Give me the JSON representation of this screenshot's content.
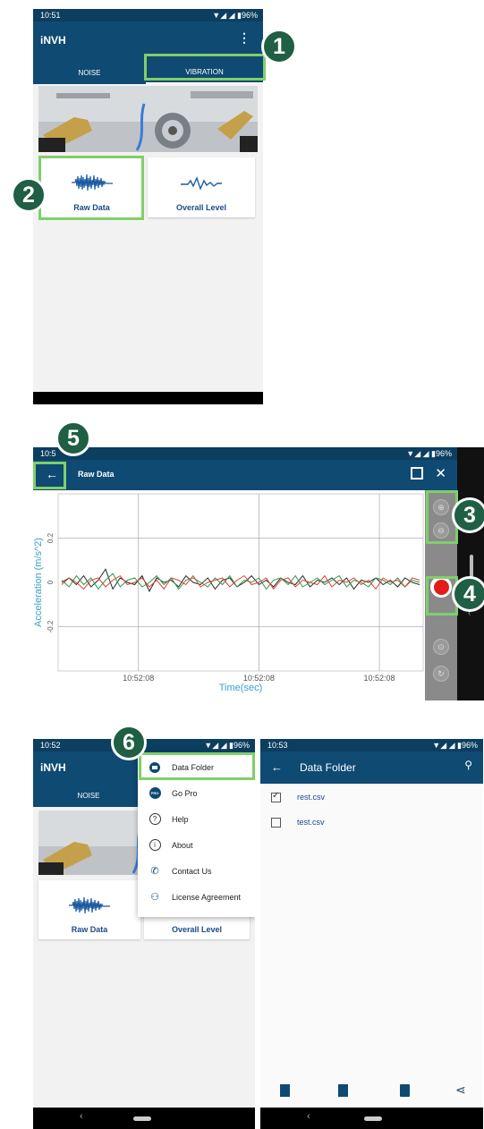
{
  "panel1": {
    "status": {
      "time": "10:51",
      "icons": "▼◢ ◢ ▮96%"
    },
    "app_title": "iNVH",
    "tabs": [
      {
        "label": "NOISE"
      },
      {
        "label": "VIBRATION"
      }
    ],
    "cards": [
      {
        "label": "Raw Data",
        "icon": "waveform-icon"
      },
      {
        "label": "Overall Level",
        "icon": "pulse-line-icon"
      }
    ]
  },
  "panel2": {
    "status": {
      "time": "10:5",
      "icons": "▼◢ ◢ ▮96%"
    },
    "title": "Raw Data",
    "chart_data": {
      "type": "line",
      "xlabel": "Time(sec)",
      "ylabel": "Acceleration (m/s^2)",
      "x_ticks": [
        "10:52:08",
        "10:52:08",
        "10:52:08"
      ],
      "y_ticks": [
        "0.2",
        "0",
        "-0.2"
      ],
      "ylim": [
        -0.4,
        0.4
      ],
      "grid": true,
      "series": [
        {
          "color": "#2a2a2a",
          "values": [
            0.0,
            0.02,
            -0.01,
            0.03,
            -0.02,
            0.01,
            0.06,
            -0.03,
            0.02,
            0.0,
            -0.01,
            0.03,
            -0.04,
            0.02,
            0.0,
            0.01,
            -0.02,
            0.03,
            0.0,
            -0.01,
            0.02,
            -0.03,
            0.01,
            0.02,
            -0.02,
            0.0,
            0.03,
            -0.01,
            0.01,
            -0.02,
            0.02,
            0.0,
            -0.01,
            0.03,
            -0.02,
            0.01,
            0.0,
            0.02,
            -0.01,
            0.02,
            -0.03,
            0.01,
            0.0,
            0.02,
            -0.01,
            0.01,
            -0.02,
            0.02,
            0.0,
            -0.01
          ]
        },
        {
          "color": "#2e9a4a",
          "values": [
            0.01,
            -0.02,
            0.03,
            -0.01,
            0.02,
            -0.03,
            0.01,
            0.04,
            -0.02,
            0.01,
            0.02,
            -0.02,
            0.0,
            0.03,
            -0.01,
            0.02,
            -0.03,
            0.01,
            0.02,
            0.0,
            -0.02,
            0.02,
            -0.01,
            0.03,
            -0.02,
            0.01,
            0.0,
            0.02,
            -0.03,
            0.01,
            0.02,
            -0.01,
            0.03,
            -0.02,
            0.0,
            0.02,
            -0.01,
            0.01,
            0.03,
            -0.02,
            0.01,
            0.0,
            -0.02,
            0.02,
            0.01,
            -0.01,
            0.02,
            -0.02,
            0.01,
            0.0
          ]
        },
        {
          "color": "#d9443a",
          "values": [
            -0.01,
            0.02,
            0.0,
            -0.03,
            0.01,
            0.02,
            -0.02,
            0.01,
            0.03,
            -0.01,
            0.0,
            0.02,
            -0.02,
            0.01,
            -0.03,
            0.02,
            0.01,
            -0.01,
            0.03,
            -0.02,
            0.0,
            0.01,
            0.02,
            -0.02,
            0.01,
            0.03,
            -0.01,
            0.0,
            0.02,
            -0.03,
            0.01,
            0.02,
            -0.02,
            0.01,
            0.0,
            -0.01,
            0.03,
            -0.02,
            0.01,
            0.0,
            0.02,
            -0.01,
            0.01,
            -0.03,
            0.02,
            0.0,
            0.01,
            -0.02,
            0.02,
            0.01
          ]
        }
      ]
    }
  },
  "panel3": {
    "status": {
      "time": "10:52",
      "icons": "▼◢ ◢ ▮96%"
    },
    "app_title": "iNVH",
    "tab_noise": "NOISE",
    "cards": [
      {
        "label": "Raw Data"
      },
      {
        "label": "Overall Level"
      }
    ],
    "menu": [
      {
        "label": "Data Folder",
        "icon": "folder-icon"
      },
      {
        "label": "Go Pro",
        "icon": "pro-badge-icon",
        "icon_text": "PRO"
      },
      {
        "label": "Help",
        "icon": "help-icon"
      },
      {
        "label": "About",
        "icon": "info-icon"
      },
      {
        "label": "Contact Us",
        "icon": "phone-icon"
      },
      {
        "label": "License Agreement",
        "icon": "license-icon"
      }
    ]
  },
  "panel4": {
    "status": {
      "time": "10:53",
      "icons": "▼◢ ◢ ▮96%"
    },
    "title": "Data Folder",
    "files": [
      {
        "name": "rest.csv",
        "checked": true
      },
      {
        "name": "test.csv",
        "checked": false
      }
    ]
  },
  "callouts": [
    "1",
    "2",
    "3",
    "4",
    "5",
    "6"
  ],
  "colors": {
    "appbar": "#0f4a73",
    "statusbar": "#0c3e60",
    "highlight": "#7fcf6a",
    "badge": "#1f5f44",
    "card_label": "#1a4a8a"
  }
}
